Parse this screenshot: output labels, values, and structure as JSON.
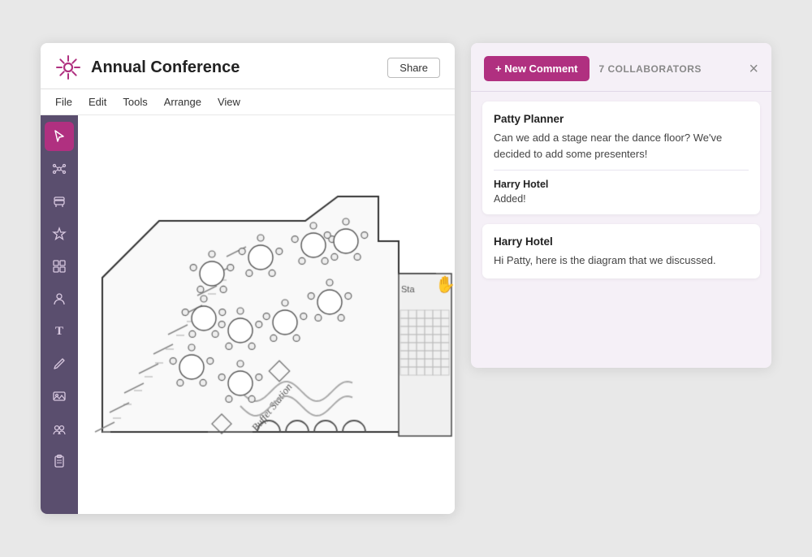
{
  "header": {
    "title": "Annual Conference",
    "share_label": "Share"
  },
  "menu": {
    "items": [
      {
        "label": "File"
      },
      {
        "label": "Edit"
      },
      {
        "label": "Tools"
      },
      {
        "label": "Arrange"
      },
      {
        "label": "View"
      }
    ]
  },
  "sidebar": {
    "tools": [
      {
        "name": "cursor-tool",
        "icon": "⬆",
        "active": true,
        "label": "Select"
      },
      {
        "name": "network-tool",
        "icon": "⬡",
        "active": false,
        "label": "Network"
      },
      {
        "name": "seat-tool",
        "icon": "🪑",
        "active": false,
        "label": "Seat"
      },
      {
        "name": "star-tool",
        "icon": "☆",
        "active": false,
        "label": "Star"
      },
      {
        "name": "grid-tool",
        "icon": "⊞",
        "active": false,
        "label": "Grid"
      },
      {
        "name": "person-tool",
        "icon": "👤",
        "active": false,
        "label": "Person"
      },
      {
        "name": "text-tool",
        "icon": "T",
        "active": false,
        "label": "Text"
      },
      {
        "name": "pen-tool",
        "icon": "✏",
        "active": false,
        "label": "Pen"
      },
      {
        "name": "image-tool",
        "icon": "🖼",
        "active": false,
        "label": "Image"
      },
      {
        "name": "group-tool",
        "icon": "👥",
        "active": false,
        "label": "Group"
      },
      {
        "name": "clipboard-tool",
        "icon": "📋",
        "active": false,
        "label": "Clipboard"
      }
    ]
  },
  "comments_panel": {
    "new_comment_label": "+ New Comment",
    "collaborators_label": "7 COLLABORATORS",
    "close_label": "×",
    "comments": [
      {
        "id": "comment-1",
        "author": "Patty Planner",
        "text": "Can we add a stage near the dance floor? We've decided to add some presenters!",
        "replies": [
          {
            "author": "Harry Hotel",
            "text": "Added!"
          }
        ]
      },
      {
        "id": "comment-2",
        "author": "Harry Hotel",
        "text": "Hi Patty, here is the diagram that we discussed.",
        "replies": []
      }
    ]
  },
  "canvas": {
    "buffet_station_label": "Buffet Station",
    "stage_label": "Sta"
  },
  "colors": {
    "accent": "#b03080",
    "sidebar_bg": "#5a4e6e",
    "panel_bg": "#f5f0f7"
  }
}
